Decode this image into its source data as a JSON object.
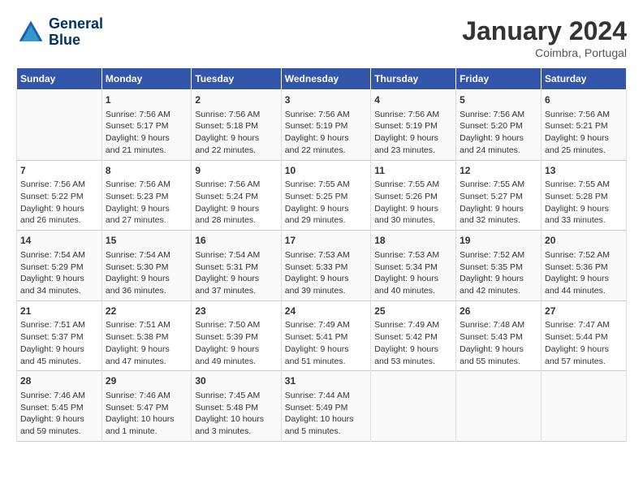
{
  "header": {
    "logo_line1": "General",
    "logo_line2": "Blue",
    "month_title": "January 2024",
    "location": "Coimbra, Portugal"
  },
  "days_of_week": [
    "Sunday",
    "Monday",
    "Tuesday",
    "Wednesday",
    "Thursday",
    "Friday",
    "Saturday"
  ],
  "weeks": [
    [
      {
        "day": "",
        "info": ""
      },
      {
        "day": "1",
        "info": "Sunrise: 7:56 AM\nSunset: 5:17 PM\nDaylight: 9 hours\nand 21 minutes."
      },
      {
        "day": "2",
        "info": "Sunrise: 7:56 AM\nSunset: 5:18 PM\nDaylight: 9 hours\nand 22 minutes."
      },
      {
        "day": "3",
        "info": "Sunrise: 7:56 AM\nSunset: 5:19 PM\nDaylight: 9 hours\nand 22 minutes."
      },
      {
        "day": "4",
        "info": "Sunrise: 7:56 AM\nSunset: 5:19 PM\nDaylight: 9 hours\nand 23 minutes."
      },
      {
        "day": "5",
        "info": "Sunrise: 7:56 AM\nSunset: 5:20 PM\nDaylight: 9 hours\nand 24 minutes."
      },
      {
        "day": "6",
        "info": "Sunrise: 7:56 AM\nSunset: 5:21 PM\nDaylight: 9 hours\nand 25 minutes."
      }
    ],
    [
      {
        "day": "7",
        "info": "Sunrise: 7:56 AM\nSunset: 5:22 PM\nDaylight: 9 hours\nand 26 minutes."
      },
      {
        "day": "8",
        "info": "Sunrise: 7:56 AM\nSunset: 5:23 PM\nDaylight: 9 hours\nand 27 minutes."
      },
      {
        "day": "9",
        "info": "Sunrise: 7:56 AM\nSunset: 5:24 PM\nDaylight: 9 hours\nand 28 minutes."
      },
      {
        "day": "10",
        "info": "Sunrise: 7:55 AM\nSunset: 5:25 PM\nDaylight: 9 hours\nand 29 minutes."
      },
      {
        "day": "11",
        "info": "Sunrise: 7:55 AM\nSunset: 5:26 PM\nDaylight: 9 hours\nand 30 minutes."
      },
      {
        "day": "12",
        "info": "Sunrise: 7:55 AM\nSunset: 5:27 PM\nDaylight: 9 hours\nand 32 minutes."
      },
      {
        "day": "13",
        "info": "Sunrise: 7:55 AM\nSunset: 5:28 PM\nDaylight: 9 hours\nand 33 minutes."
      }
    ],
    [
      {
        "day": "14",
        "info": "Sunrise: 7:54 AM\nSunset: 5:29 PM\nDaylight: 9 hours\nand 34 minutes."
      },
      {
        "day": "15",
        "info": "Sunrise: 7:54 AM\nSunset: 5:30 PM\nDaylight: 9 hours\nand 36 minutes."
      },
      {
        "day": "16",
        "info": "Sunrise: 7:54 AM\nSunset: 5:31 PM\nDaylight: 9 hours\nand 37 minutes."
      },
      {
        "day": "17",
        "info": "Sunrise: 7:53 AM\nSunset: 5:33 PM\nDaylight: 9 hours\nand 39 minutes."
      },
      {
        "day": "18",
        "info": "Sunrise: 7:53 AM\nSunset: 5:34 PM\nDaylight: 9 hours\nand 40 minutes."
      },
      {
        "day": "19",
        "info": "Sunrise: 7:52 AM\nSunset: 5:35 PM\nDaylight: 9 hours\nand 42 minutes."
      },
      {
        "day": "20",
        "info": "Sunrise: 7:52 AM\nSunset: 5:36 PM\nDaylight: 9 hours\nand 44 minutes."
      }
    ],
    [
      {
        "day": "21",
        "info": "Sunrise: 7:51 AM\nSunset: 5:37 PM\nDaylight: 9 hours\nand 45 minutes."
      },
      {
        "day": "22",
        "info": "Sunrise: 7:51 AM\nSunset: 5:38 PM\nDaylight: 9 hours\nand 47 minutes."
      },
      {
        "day": "23",
        "info": "Sunrise: 7:50 AM\nSunset: 5:39 PM\nDaylight: 9 hours\nand 49 minutes."
      },
      {
        "day": "24",
        "info": "Sunrise: 7:49 AM\nSunset: 5:41 PM\nDaylight: 9 hours\nand 51 minutes."
      },
      {
        "day": "25",
        "info": "Sunrise: 7:49 AM\nSunset: 5:42 PM\nDaylight: 9 hours\nand 53 minutes."
      },
      {
        "day": "26",
        "info": "Sunrise: 7:48 AM\nSunset: 5:43 PM\nDaylight: 9 hours\nand 55 minutes."
      },
      {
        "day": "27",
        "info": "Sunrise: 7:47 AM\nSunset: 5:44 PM\nDaylight: 9 hours\nand 57 minutes."
      }
    ],
    [
      {
        "day": "28",
        "info": "Sunrise: 7:46 AM\nSunset: 5:45 PM\nDaylight: 9 hours\nand 59 minutes."
      },
      {
        "day": "29",
        "info": "Sunrise: 7:46 AM\nSunset: 5:47 PM\nDaylight: 10 hours\nand 1 minute."
      },
      {
        "day": "30",
        "info": "Sunrise: 7:45 AM\nSunset: 5:48 PM\nDaylight: 10 hours\nand 3 minutes."
      },
      {
        "day": "31",
        "info": "Sunrise: 7:44 AM\nSunset: 5:49 PM\nDaylight: 10 hours\nand 5 minutes."
      },
      {
        "day": "",
        "info": ""
      },
      {
        "day": "",
        "info": ""
      },
      {
        "day": "",
        "info": ""
      }
    ]
  ]
}
